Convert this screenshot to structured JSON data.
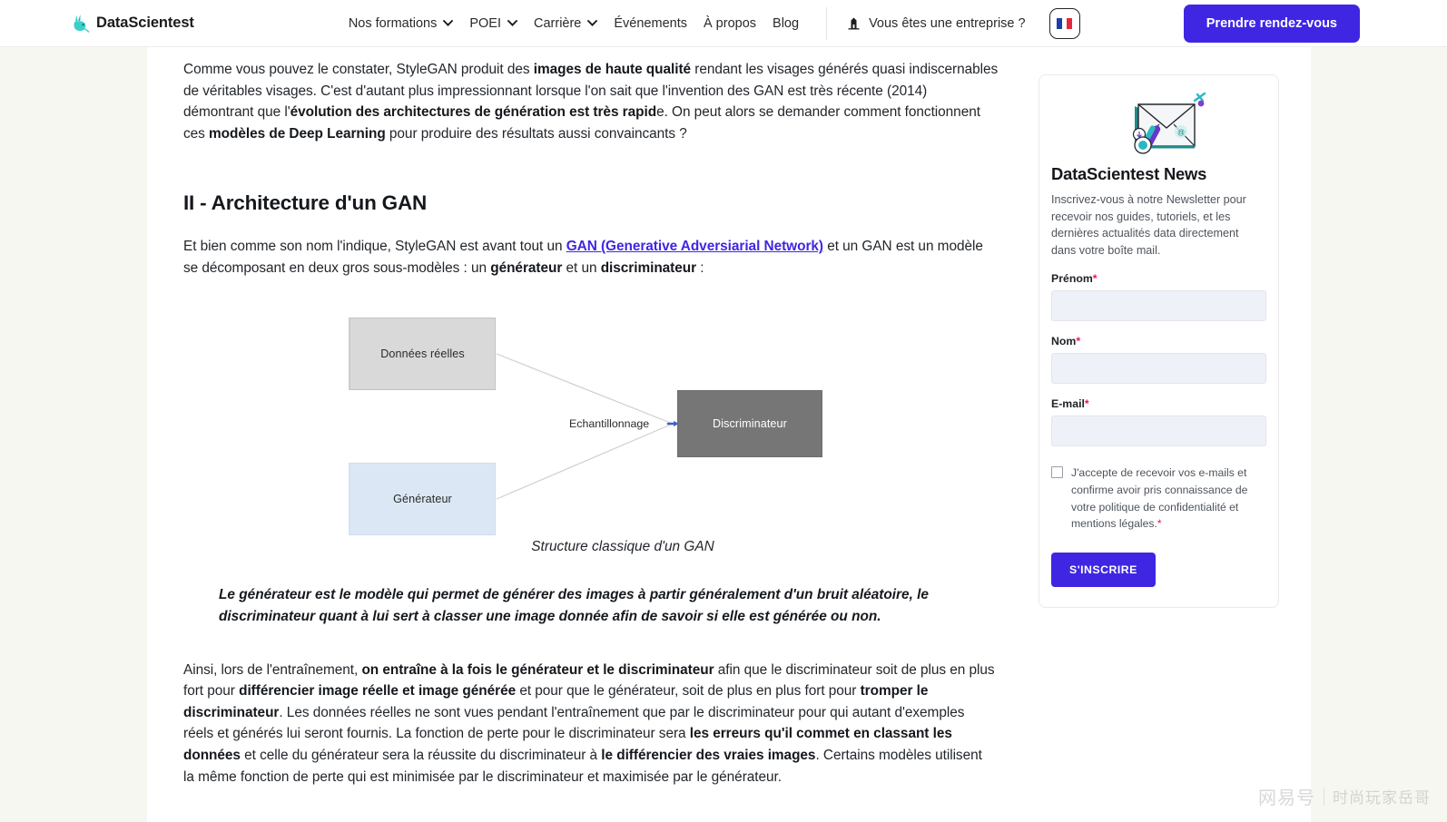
{
  "header": {
    "brand": "DataScientest",
    "logo_icon": "datascientest-rabbit-logo",
    "nav": [
      {
        "label": "Nos formations",
        "has_chevron": true
      },
      {
        "label": "POEI",
        "has_chevron": true
      },
      {
        "label": "Carrière",
        "has_chevron": true
      },
      {
        "label": "Événements",
        "has_chevron": false
      },
      {
        "label": "À propos",
        "has_chevron": false
      },
      {
        "label": "Blog",
        "has_chevron": false
      }
    ],
    "enterprise_label": "Vous êtes une entreprise ?",
    "enterprise_icon": "building-icon",
    "language_flag": "france-flag-icon",
    "cta_label": "Prendre rendez-vous",
    "cta_color": "#3f26e3"
  },
  "article": {
    "para1": {
      "s1": "Comme vous pouvez le constater, StyleGAN produit des ",
      "b1": "images de haute qualité",
      "s2": " rendant les visages générés quasi indiscernables de véritables visages. C'est d'autant plus impressionnant lorsque l'on sait que l'invention des GAN est très récente (2014) démontrant que l'",
      "b2": "évolution des architectures de génération est très rapid",
      "s3": "e. On peut alors se demander comment fonctionnent ces ",
      "b3": "modèles de Deep Learning",
      "s4": " pour produire des résultats aussi convaincants ?"
    },
    "section_title": "II - Architecture d'un GAN",
    "para2": {
      "s1": "Et bien comme son nom l'indique, StyleGAN est avant tout un ",
      "link": "GAN (Generative Adversiarial Network)",
      "s2": " et un GAN est un modèle se décomposant en deux gros sous-modèles : un ",
      "b1": "générateur",
      "s3": " et un ",
      "b2": "discriminateur",
      "s4": " :"
    },
    "figure": {
      "box_real": "Données réelles",
      "box_generator": "Générateur",
      "box_discriminator": "Discriminateur",
      "edge_label": "Echantillonnage",
      "caption": "Structure classique d'un GAN",
      "colors": {
        "real": "#d9d9d9",
        "generator": "#dbe7f5",
        "discriminator": "#767676"
      }
    },
    "pullquote": "Le générateur est le modèle qui permet de générer des images à partir généralement d'un bruit aléatoire, le discriminateur quant à lui sert à classer une image donnée afin de savoir si elle est générée ou non.",
    "para3": {
      "s1": "Ainsi, lors de l'entraînement, ",
      "b1": "on entraîne à la fois le générateur et le discriminateur",
      "s2": " afin que le discriminateur soit de plus en plus fort pour ",
      "b2": "différencier image réelle et image générée",
      "s3": " et pour que le générateur, soit de plus en plus fort pour ",
      "b3": "tromper le discriminateur",
      "s4": ". Les données réelles ne sont vues pendant l'entraînement que par le discriminateur pour qui autant d'exemples réels et générés lui seront fournis. La fonction de perte pour le discriminateur sera ",
      "b4": "les erreurs qu'il commet en classant les données",
      "s5": " et celle du générateur sera la réussite du discriminateur à ",
      "b5": "le différencier des vraies images",
      "s6": ". Certains modèles utilisent la même fonction de perte qui est minimisée par le discriminateur et maximisée par le générateur."
    }
  },
  "sidebar": {
    "icon": "envelope-newsletter-icon",
    "title": "DataScientest News",
    "description": "Inscrivez-vous à notre Newsletter pour recevoir nos guides, tutoriels, et les dernières actualités data directement dans votre boîte mail.",
    "fields": [
      {
        "label": "Prénom",
        "required": true,
        "value": "",
        "placeholder": ""
      },
      {
        "label": "Nom",
        "required": true,
        "value": "",
        "placeholder": ""
      },
      {
        "label": "E-mail",
        "required": true,
        "value": "",
        "placeholder": ""
      }
    ],
    "consent_text": "J'accepte de recevoir vos e-mails et confirme avoir pris connaissance de votre politique de confidentialité et mentions légales.",
    "consent_required": true,
    "consent_checked": false,
    "submit_label": "S'INSCRIRE",
    "submit_color": "#3f26e3"
  },
  "watermark": {
    "brand": "网易号",
    "user": "时尚玩家岳哥"
  }
}
